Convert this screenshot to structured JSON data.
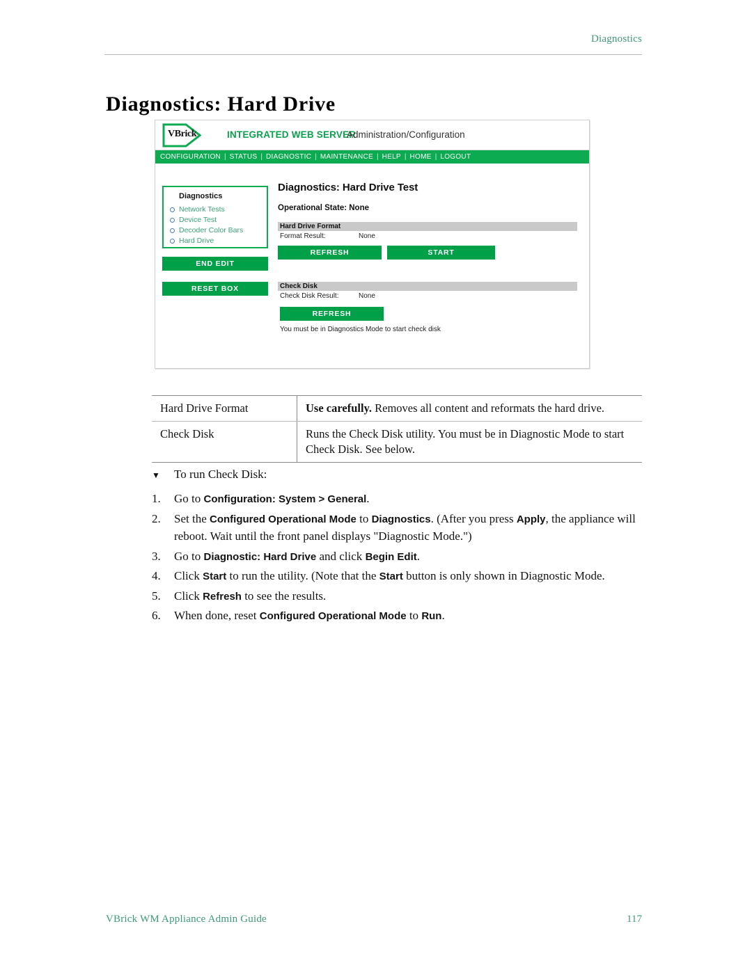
{
  "running_header": "Diagnostics",
  "page_title": "Diagnostics: Hard Drive",
  "screenshot": {
    "brand": {
      "logo_text": "VBrick",
      "product": "INTEGRATED WEB SERVER",
      "subtitle": "Administration/Configuration"
    },
    "nav": [
      "CONFIGURATION",
      "STATUS",
      "DIAGNOSTIC",
      "MAINTENANCE",
      "HELP",
      "HOME",
      "LOGOUT"
    ],
    "nav_separator": "|",
    "sidebar": {
      "title": "Diagnostics",
      "links": [
        "Network Tests",
        "Device Test",
        "Decoder Color Bars",
        "Hard Drive"
      ],
      "buttons": [
        "END EDIT",
        "RESET BOX"
      ]
    },
    "main": {
      "heading": "Diagnostics: Hard Drive Test",
      "operational_state": "Operational State: None",
      "format_section": {
        "bar_label": "Hard Drive Format",
        "result_key": "Format Result:",
        "result_value": "None",
        "refresh_button": "REFRESH",
        "start_button": "START"
      },
      "checkdisk_section": {
        "bar_label": "Check Disk",
        "result_key": "Check Disk Result:",
        "result_value": "None",
        "refresh_button": "REFRESH",
        "note": "You must be in Diagnostics Mode to start check disk"
      }
    },
    "colors": {
      "brand_green": "#0AA24C",
      "nav_green": "#0CAA51",
      "button_green": "#00A049",
      "section_bar_gray": "#C9C9C9",
      "link_green": "#39A573"
    }
  },
  "table": {
    "rows": [
      {
        "name": "Hard Drive Format",
        "desc_bold": "Use carefully.",
        "desc_rest": " Removes all content and reformats the hard drive."
      },
      {
        "name": "Check Disk",
        "desc_bold": "",
        "desc_rest": "Runs the Check Disk utility. You must be in Diagnostic Mode to start Check Disk. See below."
      }
    ]
  },
  "procedure": {
    "marker": "▼",
    "lead": "To run Check Disk:",
    "steps": [
      {
        "num": "1.",
        "parts": [
          {
            "t": "Go to ",
            "b": false
          },
          {
            "t": "Configuration: System > General",
            "b": true
          },
          {
            "t": ".",
            "b": false
          }
        ]
      },
      {
        "num": "2.",
        "parts": [
          {
            "t": "Set the ",
            "b": false
          },
          {
            "t": "Configured Operational Mode",
            "b": true
          },
          {
            "t": " to ",
            "b": false
          },
          {
            "t": "Diagnostics",
            "b": true
          },
          {
            "t": ". (After you press ",
            "b": false
          },
          {
            "t": "Apply",
            "b": true
          },
          {
            "t": ", the appliance will reboot. Wait until the front panel displays \"Diagnostic Mode.\")",
            "b": false
          }
        ]
      },
      {
        "num": "3.",
        "parts": [
          {
            "t": "Go to ",
            "b": false
          },
          {
            "t": "Diagnostic: Hard Drive",
            "b": true
          },
          {
            "t": " and click ",
            "b": false
          },
          {
            "t": "Begin Edit",
            "b": true
          },
          {
            "t": ".",
            "b": false
          }
        ]
      },
      {
        "num": "4.",
        "parts": [
          {
            "t": "Click ",
            "b": false
          },
          {
            "t": "Start",
            "b": true
          },
          {
            "t": " to run the utility. (Note that the ",
            "b": false
          },
          {
            "t": "Start",
            "b": true
          },
          {
            "t": " button is only shown in Diagnostic Mode.",
            "b": false
          }
        ]
      },
      {
        "num": "5.",
        "parts": [
          {
            "t": "Click ",
            "b": false
          },
          {
            "t": "Refresh",
            "b": true
          },
          {
            "t": " to see the results.",
            "b": false
          }
        ]
      },
      {
        "num": "6.",
        "parts": [
          {
            "t": "When done, reset ",
            "b": false
          },
          {
            "t": "Configured Operational Mode",
            "b": true
          },
          {
            "t": " to ",
            "b": false
          },
          {
            "t": "Run",
            "b": true
          },
          {
            "t": ".",
            "b": false
          }
        ]
      }
    ]
  },
  "footer": {
    "left": "VBrick WM Appliance Admin Guide",
    "page_number": "117"
  }
}
